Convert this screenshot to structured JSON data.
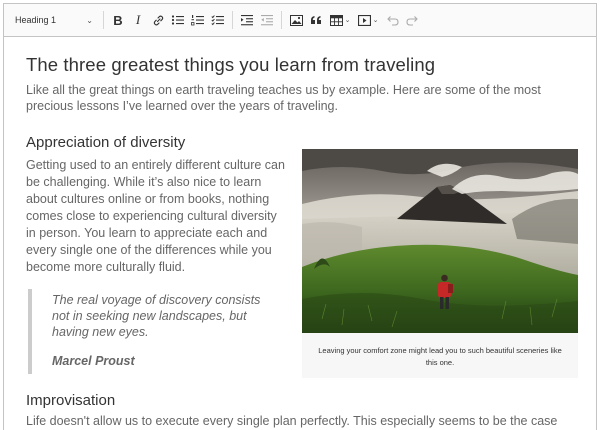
{
  "toolbar": {
    "heading_select": "Heading 1",
    "buttons": [
      "bold",
      "italic",
      "link",
      "bulleted-list",
      "numbered-list",
      "todo-list",
      "indent",
      "outdent",
      "image",
      "block-quote",
      "table",
      "media",
      "undo",
      "redo"
    ]
  },
  "article": {
    "title": "The three greatest things you learn from traveling",
    "intro": "Like all the great things on earth traveling teaches us by example. Here are some of the most precious lessons I’ve learned over the years of traveling.",
    "section1": {
      "heading": "Appreciation of diversity",
      "body": "Getting used to an entirely different culture can be challenging. While it’s also nice to learn about cultures online or from books, nothing comes close to experiencing cultural diversity in person. You learn to appreciate each and every single one of the differences while you become more culturally fluid."
    },
    "quote": {
      "text": "The real voyage of discovery consists not in seeking new landscapes, but having new eyes.",
      "author": "Marcel Proust"
    },
    "figure": {
      "caption": "Leaving your comfort zone might lead you to such beautiful sceneries like this one."
    },
    "section2": {
      "heading": "Improvisation",
      "body": "Life doesn't allow us to execute every single plan perfectly. This especially seems to be the case"
    }
  },
  "colors": {
    "text_primary": "#333333",
    "text_secondary": "#666666",
    "toolbar_bg": "#fafafa",
    "border": "#c4c4c4",
    "quote_border": "#cccccc"
  }
}
